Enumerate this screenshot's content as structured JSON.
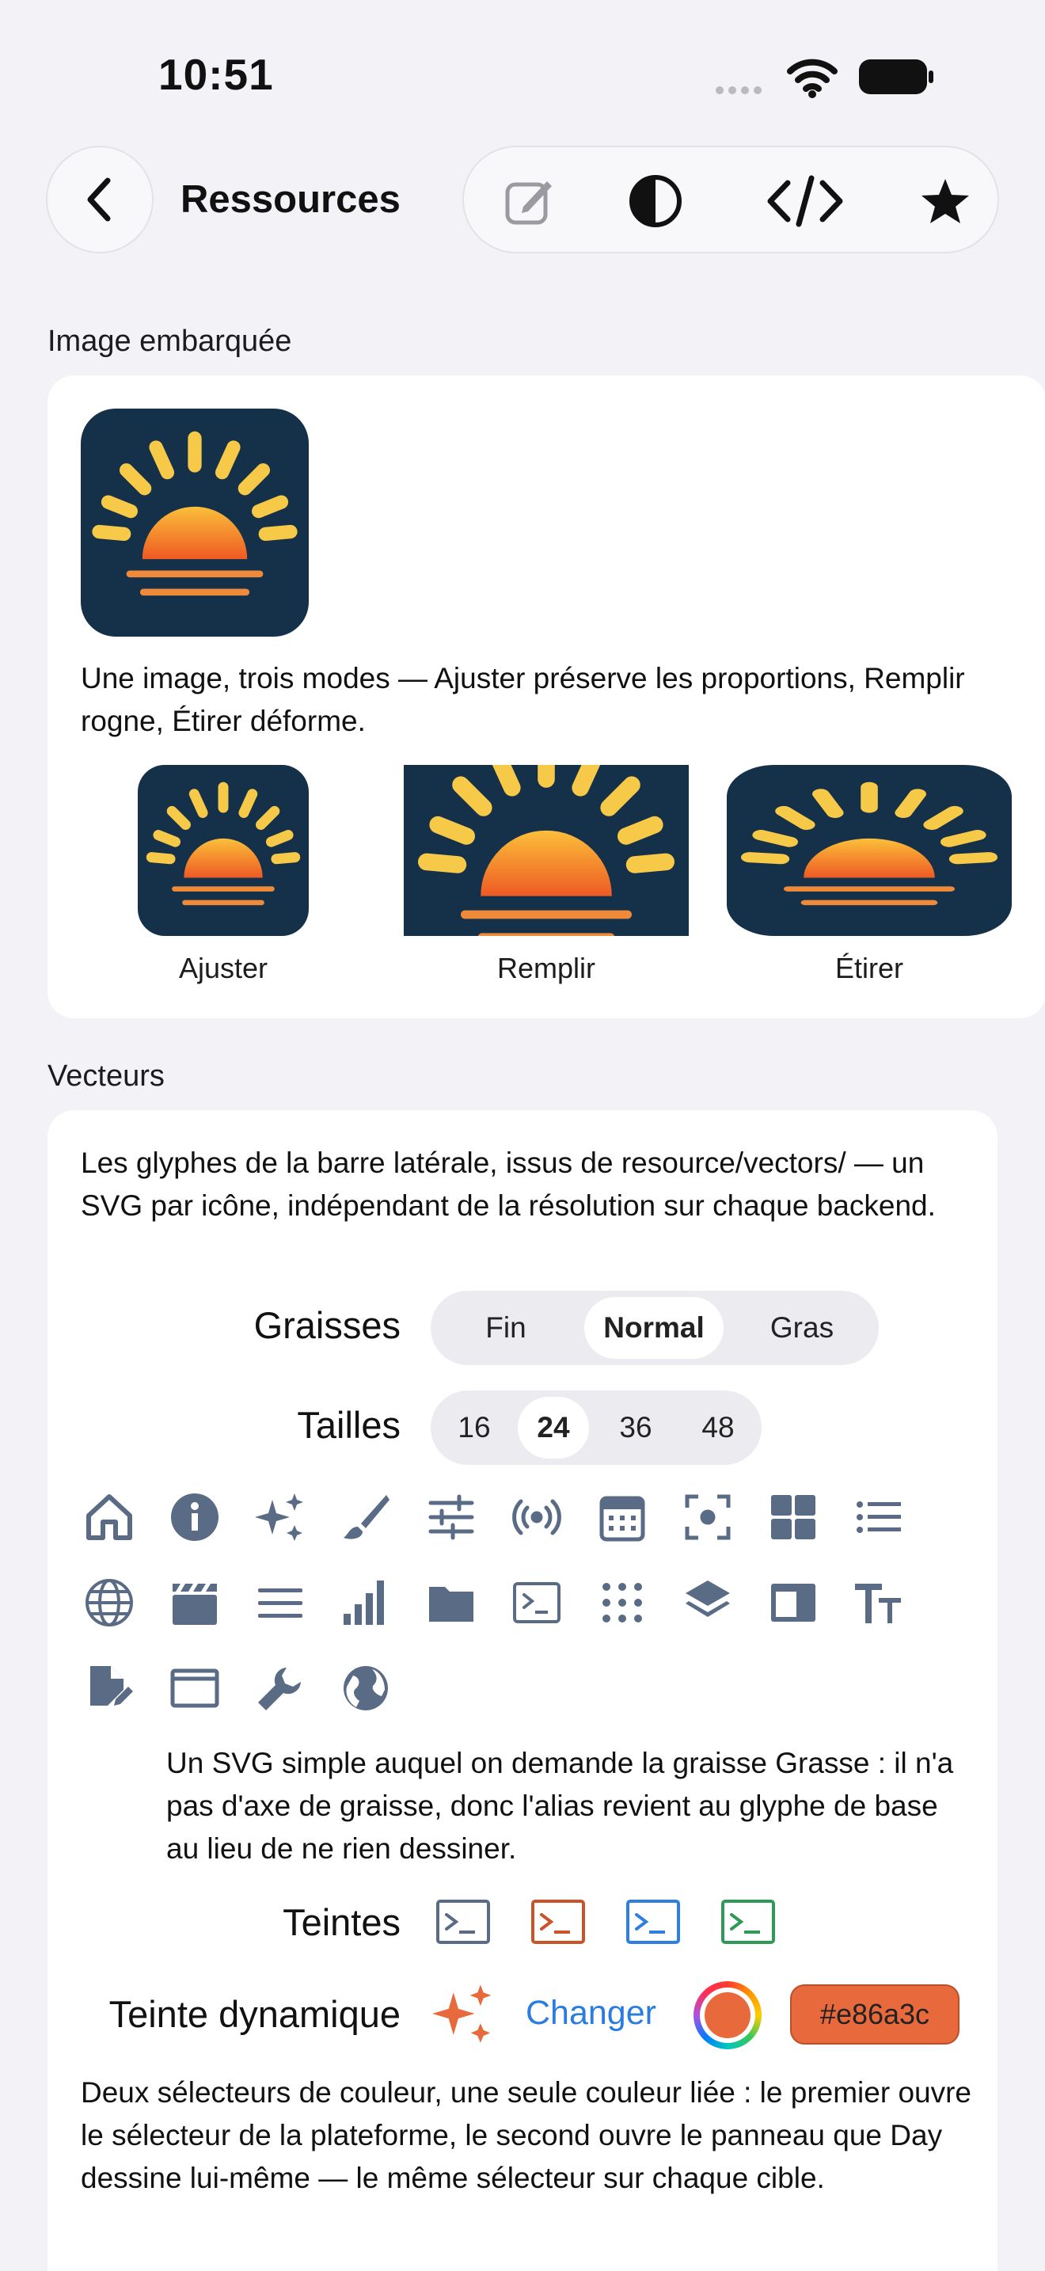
{
  "status": {
    "time": "10:51"
  },
  "nav": {
    "title": "Ressources"
  },
  "toolbar": {
    "icons": [
      "compose-icon",
      "contrast-icon",
      "code-icon",
      "star-icon"
    ]
  },
  "embedded": {
    "section_label": "Image embarquée",
    "description": "Une image, trois modes — Ajuster préserve les proportions, Remplir rogne, Étirer déforme.",
    "modes": [
      "Ajuster",
      "Remplir",
      "Étirer"
    ]
  },
  "vectors": {
    "section_label": "Vecteurs",
    "description": "Les glyphes de la barre latérale, issus de resource/vectors/ — un SVG par icône, indépendant de la résolution sur chaque backend.",
    "weights": {
      "label": "Graisses",
      "options": [
        "Fin",
        "Normal",
        "Gras"
      ],
      "selected": "Normal"
    },
    "sizes": {
      "label": "Tailles",
      "options": [
        "16",
        "24",
        "36",
        "48"
      ],
      "selected": "24"
    },
    "icons": [
      "home-icon",
      "info-icon",
      "sparkles-icon",
      "paintbrush-icon",
      "sliders-icon",
      "broadcast-icon",
      "calendar-icon",
      "focus-icon",
      "grid-icon",
      "list-icon",
      "globe-icon",
      "clapperboard-icon",
      "menu-icon",
      "bars-chart-icon",
      "folder-icon",
      "terminal-icon",
      "dots-grid-icon",
      "layers-icon",
      "window-sidebar-icon",
      "text-size-icon",
      "doc-edit-icon",
      "window-icon",
      "wrench-icon",
      "earth-icon"
    ],
    "fallback_note": "Un SVG simple auquel on demande la graisse Grasse : il n'a pas d'axe de graisse, donc l'alias revient au glyphe de base au lieu de ne rien dessiner.",
    "tints": {
      "label": "Teintes",
      "colors": [
        "#5a6b86",
        "#c9542a",
        "#2f7fe0",
        "#2f9a55"
      ]
    },
    "dynamic_tint": {
      "label": "Teinte dynamique",
      "change_label": "Changer",
      "color": "#e86a3c",
      "hex": "#e86a3c"
    },
    "picker_note": "Deux sélecteurs de couleur, une seule couleur liée : le premier ouvre le sélecteur de la plateforme, le second ouvre le panneau que Day dessine lui-même — le même sélecteur sur chaque cible."
  },
  "colors": {
    "icon_gray": "#5a6b86",
    "accent_blue": "#2a7cde",
    "app_bg": "#153049"
  }
}
